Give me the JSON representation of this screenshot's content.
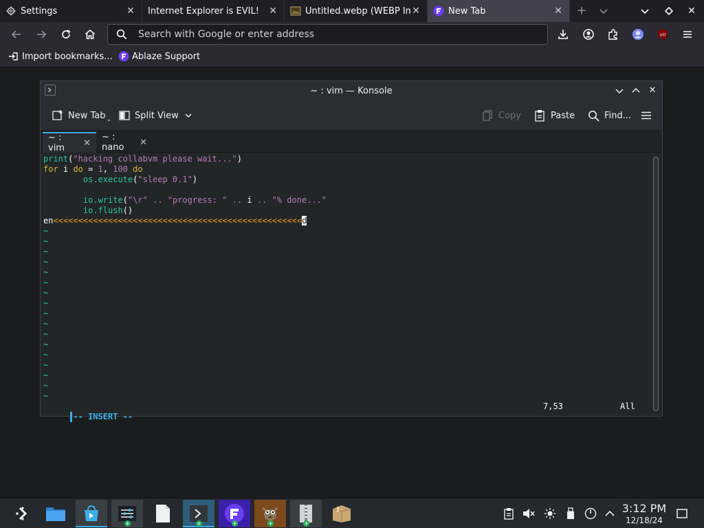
{
  "browser": {
    "tabs": [
      {
        "label": "Settings",
        "icon": "gear-icon"
      },
      {
        "label": "Internet Explorer is EVIL!",
        "icon": ""
      },
      {
        "label": "Untitled.webp (WEBP Im",
        "icon": "image-icon"
      },
      {
        "label": "New Tab",
        "icon": "ablaze-icon",
        "active": true
      }
    ],
    "url_placeholder": "Search with Google or enter address",
    "bookmarks": [
      {
        "label": "Import bookmarks...",
        "icon": "import-icon"
      },
      {
        "label": "Ablaze Support",
        "icon": "ablaze-icon"
      }
    ]
  },
  "konsole": {
    "title": "~ : vim — Konsole",
    "toolbar": {
      "new_tab": "New Tab",
      "split_view": "Split View",
      "copy": "Copy",
      "paste": "Paste",
      "find": "Find..."
    },
    "tabs": [
      {
        "label": "~ : vim",
        "active": true
      },
      {
        "label": "~ : nano",
        "active": false
      }
    ],
    "lines": [
      {
        "text": "print(\"hacking collabvm please wait...\")"
      },
      {
        "text": "for i do = 1, 100 do"
      },
      {
        "text": "        os.execute(\"sleep 0.1\")"
      },
      {
        "text": ""
      },
      {
        "text": "        io.write(\"\\r\" .. \"progress: \" .. i .. \"% done...\""
      },
      {
        "text": "        io.flush()"
      },
      {
        "text": "en<<<<<<<<<<<<<<<<<<<<<<<<<<<<<<<<<<<<<<<<<<<<<<<<<<d"
      }
    ],
    "tilde_count": 17,
    "tilde": "~",
    "status": {
      "mode": "-- INSERT --",
      "position": "7,53",
      "scroll": "All"
    }
  },
  "taskbar": {
    "clock_time": "3:12 PM",
    "clock_date": "12/18/24"
  }
}
